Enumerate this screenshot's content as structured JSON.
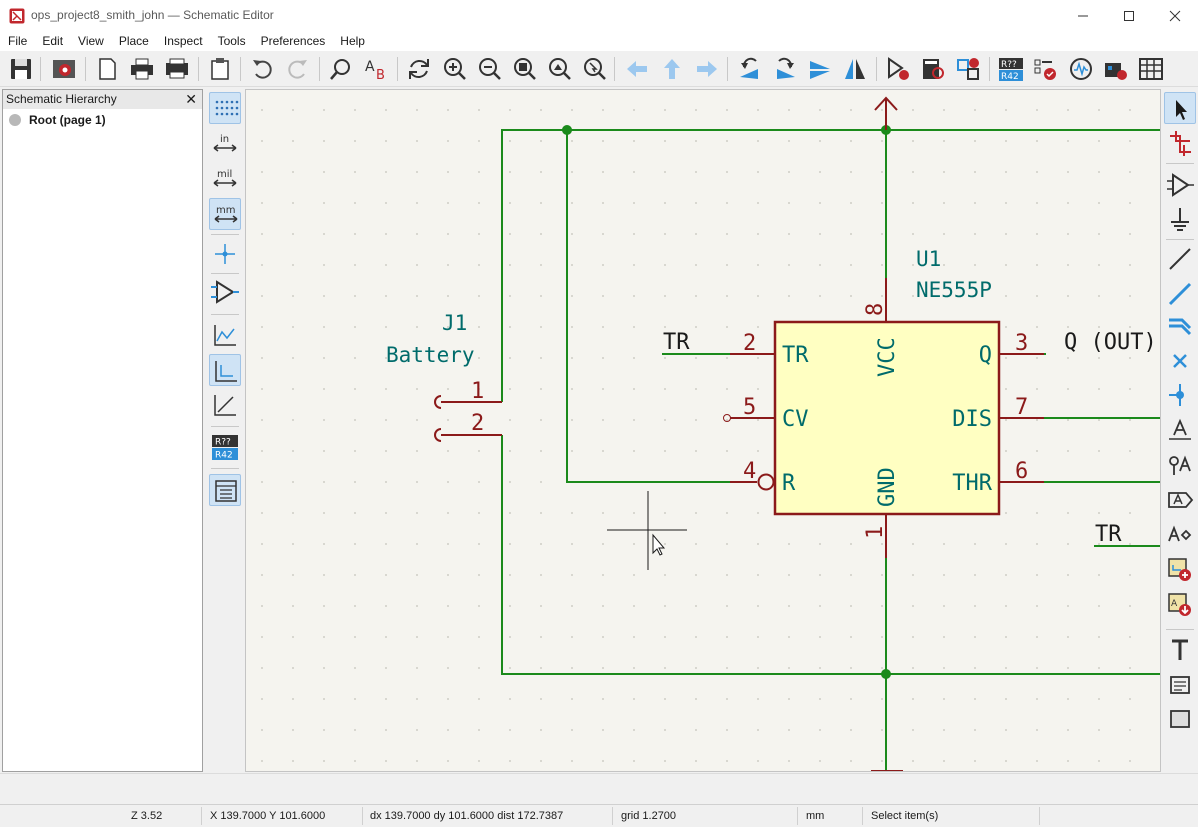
{
  "window": {
    "title": "ops_project8_smith_john — Schematic Editor",
    "controls": {
      "minimize": "—",
      "maximize": "☐",
      "close": "✕"
    }
  },
  "menu": [
    "File",
    "Edit",
    "View",
    "Place",
    "Inspect",
    "Tools",
    "Preferences",
    "Help"
  ],
  "toolbar": {
    "icons": [
      "save-icon",
      "schematic-setup-icon",
      "page-settings-icon",
      "print-icon",
      "plot-icon",
      "paste-icon",
      "undo-icon",
      "redo-icon",
      "find-icon",
      "find-replace-icon",
      "refresh-icon",
      "zoom-in-icon",
      "zoom-out-icon",
      "zoom-fit-icon",
      "zoom-objects-icon",
      "zoom-selection-icon",
      "navigate-back-icon",
      "navigate-up-icon",
      "navigate-forward-icon",
      "rotate-ccw-icon",
      "rotate-cw-icon",
      "mirror-vertical-icon",
      "mirror-horizontal-icon",
      "symbol-editor-icon",
      "symbol-browser-icon",
      "footprint-assign-icon",
      "annotate-icon",
      "erc-icon",
      "simulator-icon",
      "pcb-editor-icon",
      "bom-icon"
    ]
  },
  "hierarchy": {
    "title": "Schematic Hierarchy",
    "close": "✕",
    "root": "Root (page 1)"
  },
  "left_toolbar": {
    "unit_in": "in",
    "unit_mil": "mil",
    "unit_mm": "mm",
    "annotation_ref": "R??",
    "annotation_val": "R42"
  },
  "schematic": {
    "u1_ref": "U1",
    "u1_value": "NE555P",
    "j1_ref": "J1",
    "j1_value": "Battery",
    "pin_tr": "TR",
    "pin_cv": "CV",
    "pin_r": "R",
    "pin_vcc": "VCC",
    "pin_gnd": "GND",
    "pin_q": "Q",
    "pin_dis": "DIS",
    "pin_thr": "THR",
    "num_1": "1",
    "num_2": "2",
    "num_3": "3",
    "num_4": "4",
    "num_5": "5",
    "num_6": "6",
    "num_7": "7",
    "num_8": "8",
    "j1_pin1": "1",
    "j1_pin2": "2",
    "label_tr_left": "TR",
    "label_q_out": "Q (OUT)",
    "label_tr_right": "TR"
  },
  "status": {
    "zoom": "Z 3.52",
    "cursor": "X 139.7000  Y 101.6000",
    "delta": "dx 139.7000  dy 101.6000  dist 172.7387",
    "grid": "grid 1.2700",
    "units": "mm",
    "mode": "Select item(s)"
  },
  "colors": {
    "wire": "#1b8a1b",
    "junction": "#1b8a1b",
    "pin": "#8b1a1a",
    "symbol_body": "#ffffc2",
    "symbol_outline": "#8b1a1a",
    "field_text": "#006b6b",
    "label_text": "#1a1a1a",
    "canvas_bg": "#f5f4ef",
    "accent": "#2e8fd8"
  }
}
